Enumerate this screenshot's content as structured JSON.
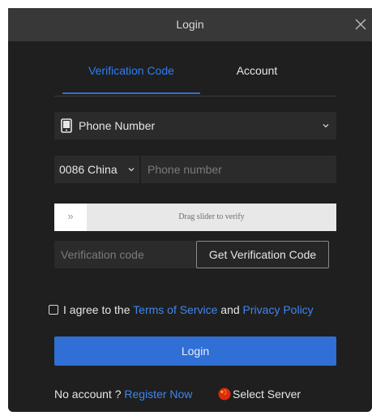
{
  "window": {
    "title": "Login"
  },
  "tabs": [
    {
      "label": "Verification Code",
      "active": true
    },
    {
      "label": "Account",
      "active": false
    }
  ],
  "login_type": {
    "selected": "Phone Number",
    "icon": "phone-icon"
  },
  "country_code": {
    "selected": "0086 China"
  },
  "phone": {
    "placeholder": "Phone number",
    "value": ""
  },
  "slider": {
    "handle_glyph": "»",
    "text": "Drag slider to verify",
    "progress": 0
  },
  "verification": {
    "placeholder": "Verification code",
    "value": "",
    "get_code_label": "Get Verification Code"
  },
  "agreement": {
    "checked": false,
    "prefix": "I agree to the",
    "terms_link": "Terms of Service",
    "conjunction": "and",
    "privacy_link": "Privacy Policy"
  },
  "login_button": {
    "label": "Login"
  },
  "footer": {
    "no_account": "No account ?",
    "register_link": "Register Now",
    "server_label": "Select Server",
    "server_icon": "china-flag-icon"
  },
  "colors": {
    "accent": "#2f6fd6",
    "link": "#3f86f0",
    "background": "#1f1f1f",
    "titlebar": "#383838",
    "field": "#2b2b2b"
  }
}
